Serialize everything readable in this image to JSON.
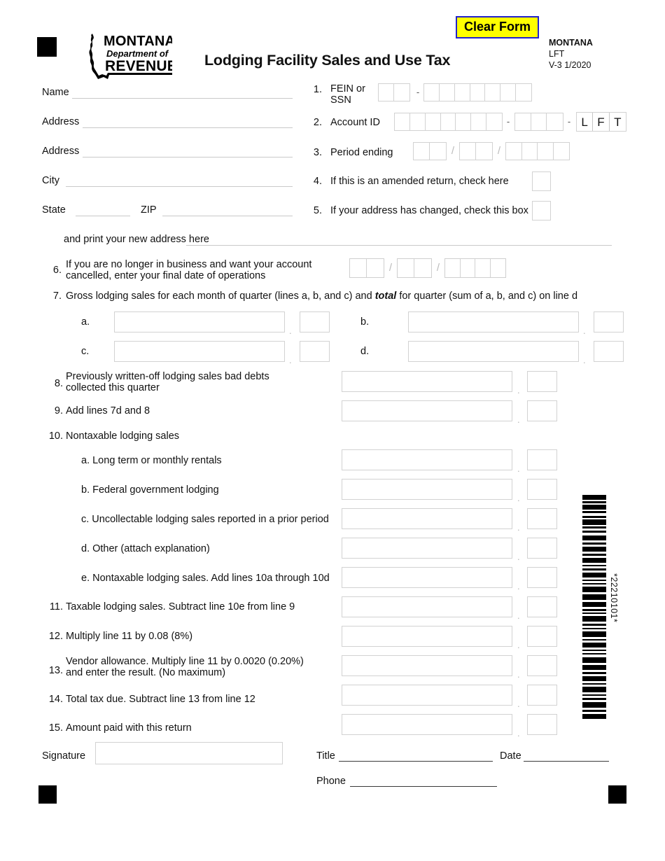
{
  "header": {
    "clear_form_label": "Clear Form",
    "title": "Lodging Facility Sales and Use Tax",
    "agency_line1": "MONTANA",
    "agency_line2": "LFT",
    "agency_line3": "V-3  1/2020",
    "logo_top": "MONTANA",
    "logo_mid": "Department of",
    "logo_bottom": "REVENUE"
  },
  "address_block": {
    "name_label": "Name",
    "address1_label": "Address",
    "address2_label": "Address",
    "city_label": "City",
    "state_label": "State",
    "zip_label": "ZIP",
    "name_value": "",
    "address1_value": "",
    "address2_value": "",
    "city_value": "",
    "state_value": "",
    "zip_value": ""
  },
  "identity": {
    "line1_number": "1.",
    "line1_label_a": "FEIN or",
    "line1_label_b": "SSN",
    "line1_prefix_boxes": 2,
    "line1_suffix_boxes": 7,
    "line1_separator": "-",
    "line2_number": "2.",
    "line2_label": "Account ID",
    "line2_group1_boxes": 7,
    "line2_group2_boxes": 3,
    "line2_separator": "-",
    "line2_suffix": [
      "L",
      "F",
      "T"
    ],
    "line3_number": "3.",
    "line3_label": "Period ending",
    "line3_month_boxes": 2,
    "line3_day_boxes": 2,
    "line3_year_boxes": 4,
    "line3_separator": "/"
  },
  "checkboxes": [
    {
      "number": "4.",
      "label": "If this is an amended return, check here",
      "checked": false
    },
    {
      "number": "5.",
      "label": "If your address has changed, check this box",
      "checked": false
    }
  ],
  "new_address": {
    "label": "and print your new address here",
    "value": ""
  },
  "line6": {
    "number": "6.",
    "text_line1": "If you are no longer in business and want your account",
    "text_line2": "cancelled, enter your final date of operations",
    "month_boxes": 2,
    "day_boxes": 2,
    "year_boxes": 4,
    "separator": "/"
  },
  "line7": {
    "number": "7.",
    "text_part1": "Gross lodging sales for each month of quarter (lines a, b, and c) and ",
    "text_emphasis": "total",
    "text_part2": " for quarter (sum of a, b, and c) on line d",
    "subrows": [
      {
        "key": "a.",
        "dollars": "",
        "cents": ""
      },
      {
        "key": "b.",
        "dollars": "",
        "cents": ""
      },
      {
        "key": "c.",
        "dollars": "",
        "cents": ""
      },
      {
        "key": "d.",
        "dollars": "",
        "cents": ""
      }
    ]
  },
  "lines": [
    {
      "number": "8.",
      "text_line1": "Previously written-off lodging sales bad debts",
      "text_line2": "collected this quarter",
      "indent": 0,
      "has_field": true,
      "dollars": "",
      "cents": ""
    },
    {
      "number": "9.",
      "text_line1": "Add lines 7d and 8",
      "text_line2": "",
      "indent": 0,
      "has_field": true,
      "dollars": "",
      "cents": ""
    },
    {
      "number": "10.",
      "text_line1": "Nontaxable lodging sales",
      "text_line2": "",
      "indent": 0,
      "has_field": false,
      "dollars": "",
      "cents": ""
    },
    {
      "number": "",
      "text_line1": "a. Long term or monthly rentals",
      "text_line2": "",
      "indent": 1,
      "has_field": true,
      "dollars": "",
      "cents": ""
    },
    {
      "number": "",
      "text_line1": "b. Federal government lodging",
      "text_line2": "",
      "indent": 1,
      "has_field": true,
      "dollars": "",
      "cents": ""
    },
    {
      "number": "",
      "text_line1": "c. Uncollectable lodging sales reported in a prior period",
      "text_line2": "",
      "indent": 1,
      "has_field": true,
      "dollars": "",
      "cents": ""
    },
    {
      "number": "",
      "text_line1": "d. Other (attach explanation)",
      "text_line2": "",
      "indent": 1,
      "has_field": true,
      "dollars": "",
      "cents": ""
    },
    {
      "number": "",
      "text_line1": "e. Nontaxable lodging sales. Add lines 10a through 10d",
      "text_line2": "",
      "indent": 1,
      "has_field": true,
      "dollars": "",
      "cents": ""
    },
    {
      "number": "11.",
      "text_line1": "Taxable lodging sales. Subtract line 10e from line 9",
      "text_line2": "",
      "indent": 0,
      "has_field": true,
      "dollars": "",
      "cents": ""
    },
    {
      "number": "12.",
      "text_line1": "Multiply line 11 by 0.08 (8%)",
      "text_line2": "",
      "indent": 0,
      "has_field": true,
      "dollars": "",
      "cents": ""
    },
    {
      "number": "13.",
      "text_line1": "Vendor allowance. Multiply line 11 by 0.0020 (0.20%)",
      "text_line2": "and enter the result. (No maximum)",
      "indent": 0,
      "has_field": true,
      "dollars": "",
      "cents": ""
    },
    {
      "number": "14.",
      "text_line1": "Total tax due. Subtract line 13 from line 12",
      "text_line2": "",
      "indent": 0,
      "has_field": true,
      "dollars": "",
      "cents": ""
    },
    {
      "number": "15.",
      "text_line1": "Amount paid with this return",
      "text_line2": "",
      "indent": 0,
      "has_field": true,
      "dollars": "",
      "cents": ""
    }
  ],
  "footer": {
    "signature_label": "Signature",
    "signature_value": "",
    "title_label": "Title",
    "title_value": "",
    "date_label": "Date",
    "date_value": "",
    "phone_label": "Phone",
    "phone_value": ""
  },
  "barcode": {
    "label": "*22210101*",
    "value": "22210101"
  },
  "colors": {
    "accent_yellow": "#ffff00",
    "accent_blue": "#2222cc",
    "field_border": "#d2d2d2",
    "rule": "#c9c9c9",
    "text": "#111111"
  }
}
